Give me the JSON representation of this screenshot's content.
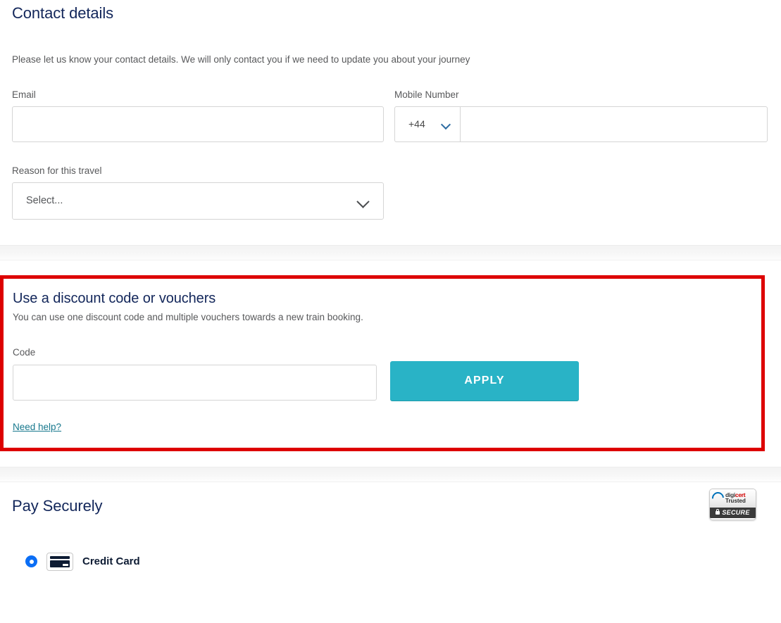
{
  "contact": {
    "title": "Contact details",
    "description": "Please let us know your contact details. We will only contact you if we need to update you about your journey",
    "email_label": "Email",
    "email_value": "",
    "email_placeholder": "",
    "mobile_label": "Mobile Number",
    "country_code": "+44",
    "mobile_value": "",
    "mobile_placeholder": "",
    "reason_label": "Reason for this travel",
    "reason_value": "Select...",
    "chevron_icon": "chevron-down-icon"
  },
  "discount": {
    "title": "Use a discount code or vouchers",
    "description": "You can use one discount code and multiple vouchers towards a new train booking.",
    "code_label": "Code",
    "code_value": "",
    "code_placeholder": "",
    "apply_label": "APPLY",
    "need_help_label": "Need help?",
    "highlight_color": "#dd0000",
    "apply_color": "#29b3c6",
    "link_color": "#17788d"
  },
  "pay": {
    "title": "Pay Securely",
    "methods": [
      {
        "label": "Credit Card",
        "selected": true,
        "icon": "credit-card-icon"
      }
    ],
    "accent_color": "#0b6ef5"
  },
  "badge": {
    "brand_first": "digi",
    "brand_second": "cert",
    "trusted_label": "Trusted",
    "secure_label": "SECURE",
    "lock_icon": "lock-icon"
  }
}
